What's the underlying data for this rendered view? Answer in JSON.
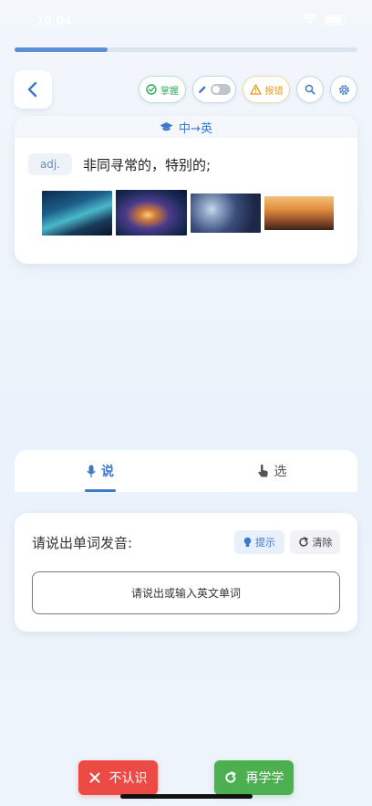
{
  "status_bar": {
    "time": "10:04"
  },
  "progress": {
    "fraction": 0.27
  },
  "toolbar": {
    "master_label": "掌握",
    "report_label": "报错",
    "toggle_state": "off"
  },
  "word_card": {
    "mode_label": "中→英",
    "part_of_speech": "adj.",
    "definition": "非同寻常的，特别的;"
  },
  "tabs": [
    {
      "label": "说",
      "active": true
    },
    {
      "label": "选",
      "active": false
    }
  ],
  "speak_panel": {
    "prompt": "请说出单词发音:",
    "hint_label": "提示",
    "clear_label": "清除",
    "input_placeholder": "请说出或输入英文单词"
  },
  "actions": {
    "unknown_label": "不认识",
    "relearn_label": "再学学"
  },
  "colors": {
    "accent": "#3d78c9",
    "master": "#2eaa5a",
    "report": "#e69a1e",
    "danger": "#ec4b45",
    "success": "#4caf50"
  }
}
